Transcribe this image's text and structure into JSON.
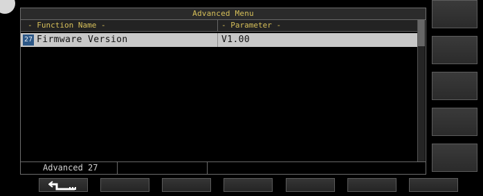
{
  "window": {
    "title": "Advanced Menu"
  },
  "table": {
    "headers": {
      "function_name": "- Function Name -",
      "parameter": "- Parameter -"
    },
    "rows": [
      {
        "index": "27",
        "function_name": "Firmware Version",
        "parameter": "V1.00"
      }
    ]
  },
  "status": {
    "left_label": "Advanced 27",
    "middle_value": "",
    "right_value": ""
  },
  "softkeys": [
    {
      "label": "",
      "icon": "back-arrow-icon"
    },
    {
      "label": ""
    },
    {
      "label": ""
    },
    {
      "label": ""
    },
    {
      "label": ""
    },
    {
      "label": ""
    },
    {
      "label": ""
    }
  ],
  "side_keys": [
    {
      "label": ""
    },
    {
      "label": ""
    },
    {
      "label": ""
    },
    {
      "label": ""
    },
    {
      "label": ""
    }
  ],
  "colors": {
    "background": "#000000",
    "title_text": "#d8c15a",
    "selected_row": "#c8c8c8",
    "row_index_badge": "#2d5887"
  }
}
